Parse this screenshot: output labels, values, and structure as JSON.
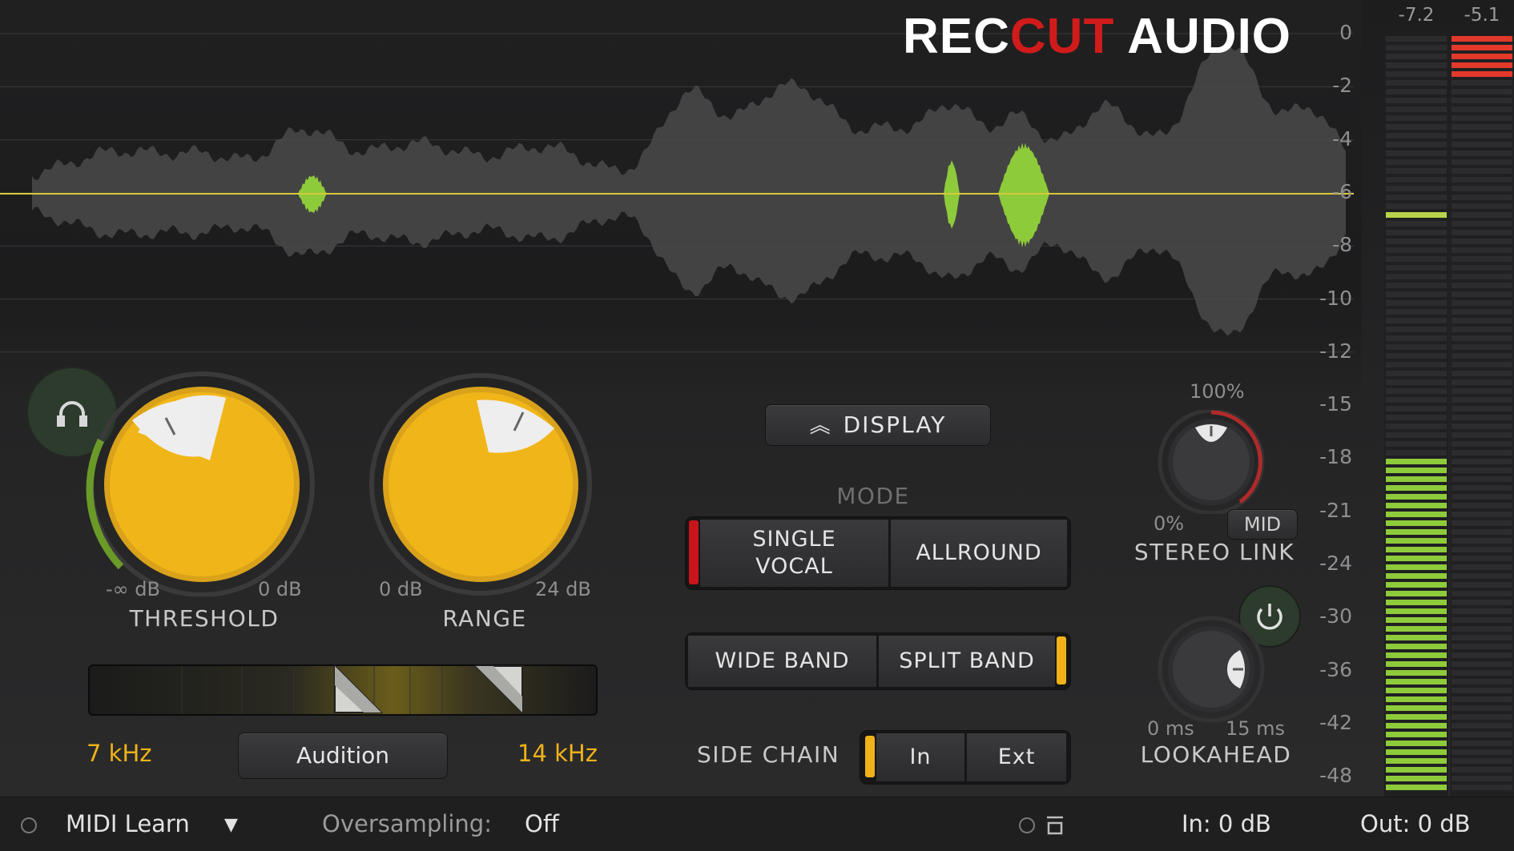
{
  "brand": {
    "logo_part1": "REC",
    "logo_part2": "CUT",
    "logo_part3": " AUDIO"
  },
  "scale": [
    "0",
    "-2",
    "-4",
    "-6",
    "-8",
    "-10",
    "-12",
    "-15",
    "-18",
    "-21",
    "-24",
    "-30",
    "-36",
    "-42",
    "-48"
  ],
  "meters": {
    "in_peak": "-7.2",
    "out_peak": "-5.1",
    "in_level": 0.45,
    "out_level": 0.0
  },
  "threshold": {
    "label": "THRESHOLD",
    "min": "-∞ dB",
    "max": "0 dB"
  },
  "range": {
    "label": "RANGE",
    "min": "0 dB",
    "max": "24 dB"
  },
  "band": {
    "low": "7 kHz",
    "high": "14 kHz",
    "audition": "Audition"
  },
  "display_button": "DISPLAY",
  "mode": {
    "title": "MODE",
    "single_vocal": "SINGLE\nVOCAL",
    "allround": "ALLROUND",
    "wide_band": "WIDE BAND",
    "split_band": "SPLIT BAND"
  },
  "side_chain": {
    "label": "SIDE CHAIN",
    "in": "In",
    "ext": "Ext"
  },
  "stereo_link": {
    "label": "STEREO LINK",
    "max": "100%",
    "min": "0%",
    "mode": "MID"
  },
  "lookahead": {
    "label": "LOOKAHEAD",
    "min": "0 ms",
    "max": "15 ms"
  },
  "footer": {
    "midi_learn": "MIDI Learn",
    "oversampling_label": "Oversampling:",
    "oversampling_value": "Off",
    "in": "In: 0 dB",
    "out": "Out: 0 dB"
  },
  "colors": {
    "accent": "#efb219",
    "knob_gold": "#f0b518",
    "red": "#c9141b",
    "green": "#8ecb3a"
  }
}
